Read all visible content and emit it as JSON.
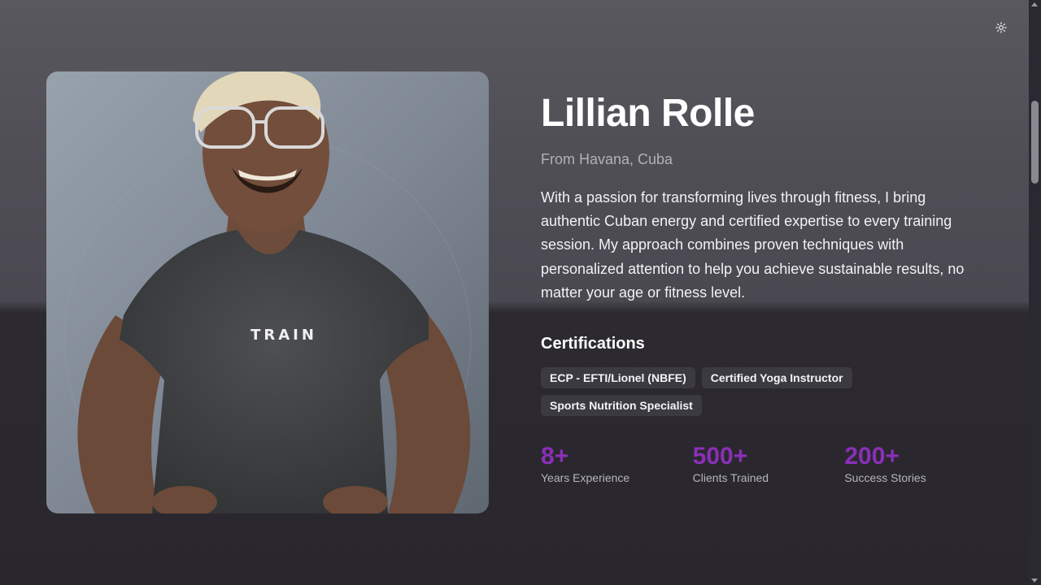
{
  "header": {
    "theme_toggle_icon": "sun-icon"
  },
  "profile": {
    "photo_alt": "Lillian Rolle",
    "shirt_text": "TRAIN",
    "name": "Lillian Rolle",
    "origin": "From Havana, Cuba",
    "bio": "With a passion for transforming lives through fitness, I bring authentic Cuban energy and certified expertise to every training session. My approach combines proven techniques with personalized attention to help you achieve sustainable results, no matter your age or fitness level."
  },
  "certifications": {
    "title": "Certifications",
    "items": [
      "ECP - EFTI/Lionel (NBFE)",
      "Certified Yoga Instructor",
      "Sports Nutrition Specialist"
    ]
  },
  "stats": [
    {
      "value": "8+",
      "label": "Years Experience"
    },
    {
      "value": "500+",
      "label": "Clients Trained"
    },
    {
      "value": "200+",
      "label": "Success Stories"
    }
  ],
  "colors": {
    "accent": "#8b2fb8",
    "chip_bg": "#3c3a41",
    "background_top": "#5a585f",
    "background_bottom": "#29272d"
  }
}
